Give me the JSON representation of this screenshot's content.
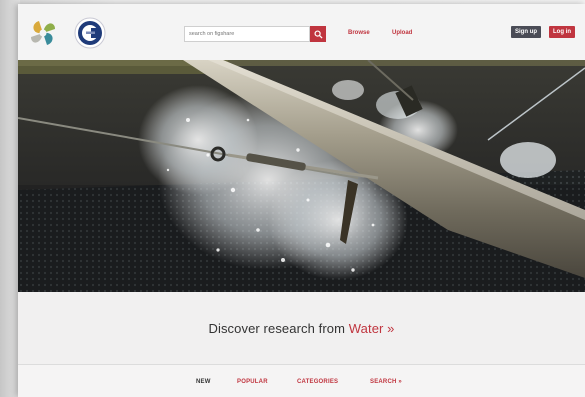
{
  "header": {
    "search": {
      "placeholder": "search on figshare"
    },
    "nav": {
      "browse": "Browse",
      "upload": "Upload"
    },
    "auth": {
      "signup": "Sign up",
      "login": "Log in"
    }
  },
  "discover": {
    "prefix": "Discover research from ",
    "topic": "Water",
    "suffix": " »"
  },
  "tabs": [
    {
      "label": "NEW"
    },
    {
      "label": "POPULAR"
    },
    {
      "label": "CATEGORIES"
    },
    {
      "label": "SEARCH »"
    }
  ],
  "colors": {
    "accent": "#c0353f",
    "dark_button": "#4a4c56"
  },
  "icons": {
    "search_button": "search-icon",
    "logo_left": "pinwheel-logo",
    "logo_right": "circle-c-logo"
  }
}
